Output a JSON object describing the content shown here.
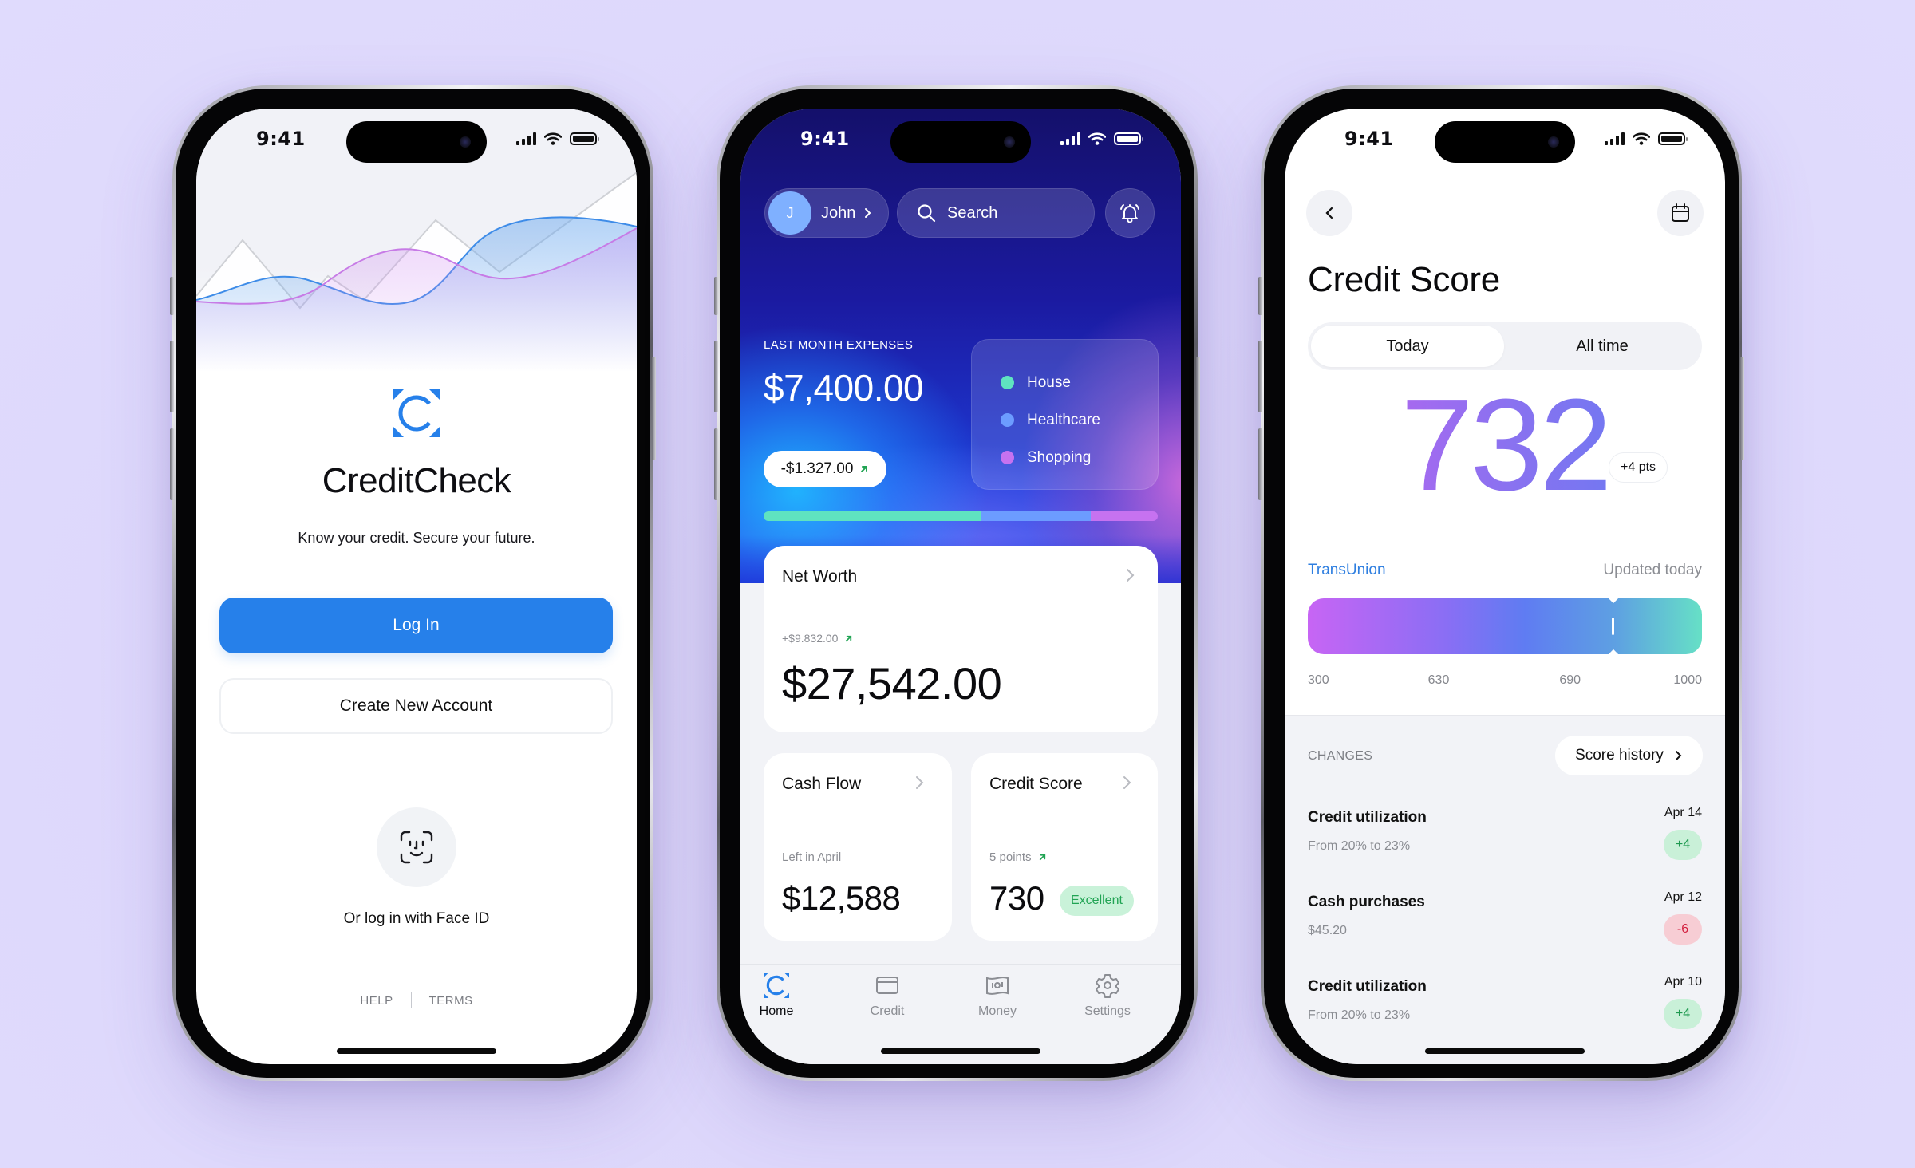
{
  "status_bar": {
    "time": "9:41"
  },
  "login_screen": {
    "app_name": "CreditCheck",
    "tagline": "Know your credit. Secure your future.",
    "login_button": "Log In",
    "create_account_button": "Create New Account",
    "face_id_label": "Or log in with Face ID",
    "footer_links": [
      "HELP",
      "TERMS"
    ],
    "brand_color": "#2680ea"
  },
  "dashboard_screen": {
    "user": {
      "initial": "J",
      "name": "John"
    },
    "search": {
      "placeholder": "Search"
    },
    "expenses": {
      "label": "LAST MONTH EXPENSES",
      "value": "$7,400.00",
      "delta": "-$1.327.00",
      "categories": [
        {
          "name": "House",
          "color": "#5fe3c0",
          "share": 0.55
        },
        {
          "name": "Healthcare",
          "color": "#6c9cff",
          "share": 0.28
        },
        {
          "name": "Shopping",
          "color": "#c672f0",
          "share": 0.17
        }
      ]
    },
    "net_worth": {
      "title": "Net Worth",
      "change": "+$9.832.00",
      "value": "$27,542.00"
    },
    "cash_flow": {
      "title": "Cash Flow",
      "sub_label": "Left in April",
      "value": "$12,588"
    },
    "credit_score": {
      "title": "Credit Score",
      "sub_label": "5 points",
      "value": "730",
      "rating": "Excellent"
    },
    "tabs": [
      {
        "label": "Home",
        "icon": "home-logo-icon",
        "active": true
      },
      {
        "label": "Credit",
        "icon": "credit-card-icon",
        "active": false
      },
      {
        "label": "Money",
        "icon": "banknote-icon",
        "active": false
      },
      {
        "label": "Settings",
        "icon": "gear-icon",
        "active": false
      }
    ]
  },
  "credit_score_screen": {
    "title": "Credit Score",
    "segments": [
      "Today",
      "All time"
    ],
    "active_segment": "Today",
    "score": "732",
    "score_change": "+4 pts",
    "bureau": "TransUnion",
    "updated": "Updated today",
    "scale": {
      "min": 300,
      "max": 1000,
      "ticks": [
        "300",
        "630",
        "690",
        "1000"
      ],
      "marker_fraction": 0.775
    },
    "changes_label": "CHANGES",
    "history_button": "Score history",
    "changes": [
      {
        "title": "Credit utilization",
        "detail": "From 20% to 23%",
        "date": "Apr 14",
        "delta": "+4",
        "positive": true
      },
      {
        "title": "Cash purchases",
        "detail": "$45.20",
        "date": "Apr 12",
        "delta": "-6",
        "positive": false
      },
      {
        "title": "Credit utilization",
        "detail": "From 20% to 23%",
        "date": "Apr 10",
        "delta": "+4",
        "positive": true
      }
    ]
  }
}
